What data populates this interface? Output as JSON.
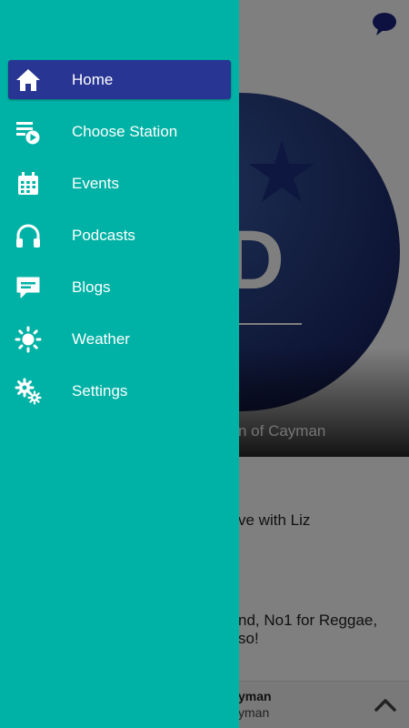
{
  "background": {
    "hero_caption": "n of Cayman",
    "content_lines": [
      "ve with Liz",
      "nd, No1 for Reggae,",
      "so!"
    ],
    "now_playing": {
      "title": "yman",
      "subtitle": "yman"
    },
    "logo_text": "ND"
  },
  "drawer": {
    "items": [
      {
        "label": "Home",
        "icon": "home-icon",
        "active": true
      },
      {
        "label": "Choose Station",
        "icon": "playlist-play-icon",
        "active": false
      },
      {
        "label": "Events",
        "icon": "calendar-icon",
        "active": false
      },
      {
        "label": "Podcasts",
        "icon": "headphones-icon",
        "active": false
      },
      {
        "label": "Blogs",
        "icon": "chat-bubble-icon",
        "active": false
      },
      {
        "label": "Weather",
        "icon": "sun-icon",
        "active": false
      },
      {
        "label": "Settings",
        "icon": "gears-icon",
        "active": false
      }
    ]
  },
  "colors": {
    "drawer_bg": "#00b2a5",
    "active_item_bg": "#283593",
    "logo_circle": "#1d2a6e"
  }
}
